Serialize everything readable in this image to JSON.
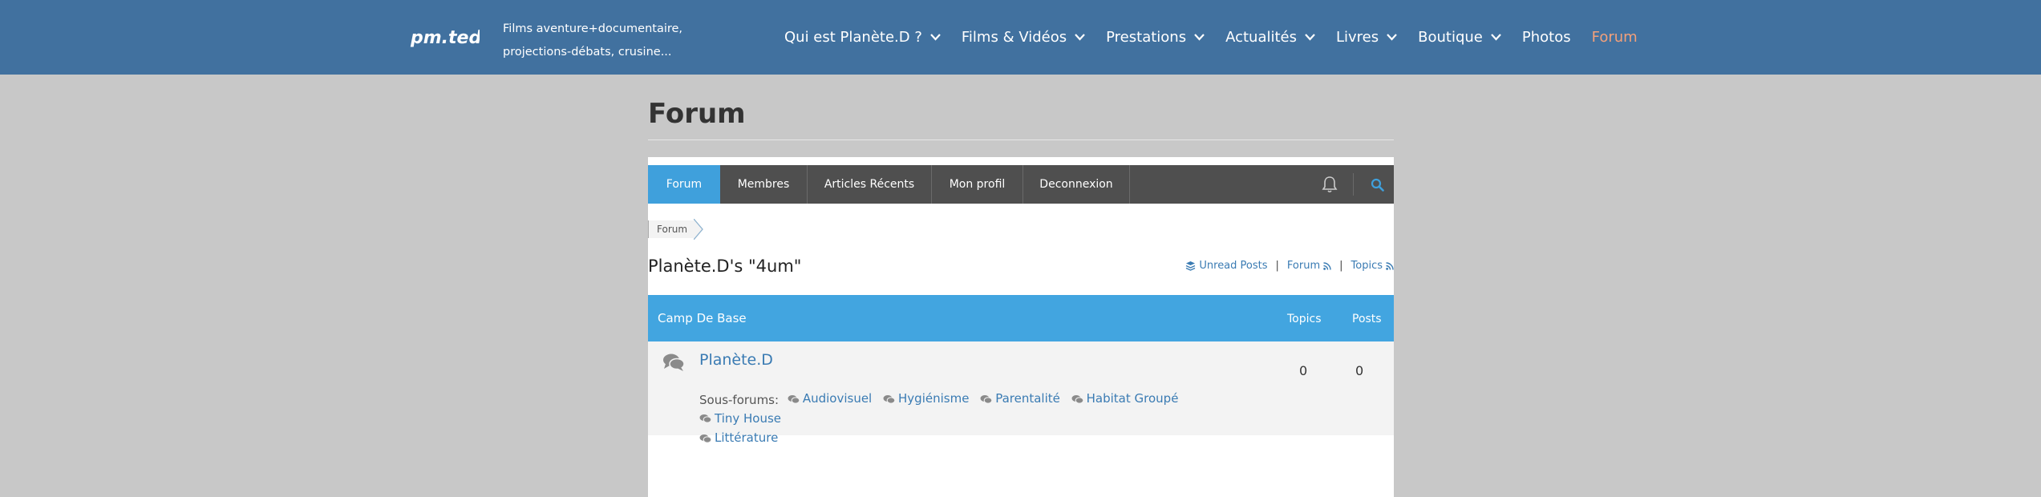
{
  "header": {
    "logo_text": "pm.ted",
    "tagline_line1": "Films aventure+documentaire,",
    "tagline_line2": "projections-débats, crusine...",
    "nav": [
      {
        "label": "Qui est Planète.D ?",
        "has_dropdown": true
      },
      {
        "label": "Films & Vidéos",
        "has_dropdown": true
      },
      {
        "label": "Prestations",
        "has_dropdown": true
      },
      {
        "label": "Actualités",
        "has_dropdown": true
      },
      {
        "label": "Livres",
        "has_dropdown": true
      },
      {
        "label": "Boutique",
        "has_dropdown": true
      },
      {
        "label": "Photos",
        "has_dropdown": false
      },
      {
        "label": "Forum",
        "has_dropdown": false,
        "active": true
      }
    ]
  },
  "page": {
    "title": "Forum"
  },
  "forum_nav": {
    "tabs": [
      "Forum",
      "Membres",
      "Articles Récents",
      "Mon profil",
      "Deconnexion"
    ],
    "active_tab": "Forum",
    "icons": [
      "bell-icon",
      "search-icon"
    ]
  },
  "breadcrumb": {
    "items": [
      "Forum"
    ]
  },
  "forum": {
    "title": "Planète.D's \"4um\"",
    "links": {
      "unread": "Unread Posts",
      "forum": "Forum",
      "topics": "Topics",
      "separator": "|"
    },
    "category": {
      "name": "Camp De Base",
      "col_topics": "Topics",
      "col_posts": "Posts"
    },
    "row": {
      "name": "Planète.D",
      "topics": "0",
      "posts": "0",
      "subforums_label": "Sous-forums:",
      "subforums": [
        "Audiovisuel",
        "Hygiénisme",
        "Parentalité",
        "Habitat Groupé",
        "Tiny House",
        "Littérature"
      ]
    }
  },
  "colors": {
    "header_bg": "#41719f",
    "page_bg": "#c8c8c8",
    "accent_blue": "#42a5e0",
    "nav_dark": "#4f4f4f",
    "link": "#3a7bb3",
    "active_nav": "#f3a07a"
  }
}
